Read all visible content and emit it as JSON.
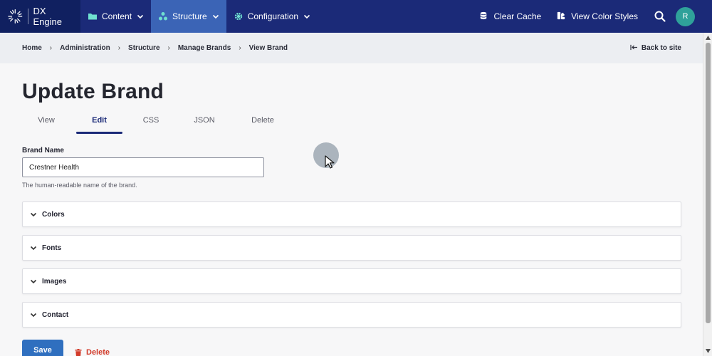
{
  "nav": {
    "brand": "DX Engine",
    "items": [
      {
        "label": "Content",
        "icon": "folder-icon"
      },
      {
        "label": "Structure",
        "icon": "sitemap-icon",
        "active": true
      },
      {
        "label": "Configuration",
        "icon": "gear-icon"
      }
    ],
    "clear_cache": "Clear Cache",
    "view_color_styles": "View Color Styles",
    "avatar_initial": "R"
  },
  "breadcrumb": [
    "Home",
    "Administration",
    "Structure",
    "Manage Brands",
    "View Brand"
  ],
  "breadcrumb_sep": "›",
  "back_to_site": "Back to site",
  "page": {
    "title": "Update Brand",
    "tabs": [
      "View",
      "Edit",
      "CSS",
      "JSON",
      "Delete"
    ],
    "active_tab": "Edit"
  },
  "form": {
    "brand_name_label": "Brand Name",
    "brand_name_value": "Crestner Health",
    "brand_name_desc": "The human-readable name of the brand.",
    "sections": [
      "Colors",
      "Fonts",
      "Images",
      "Contact"
    ],
    "save_label": "Save",
    "delete_label": "Delete"
  },
  "colors": {
    "nav_bg": "#1b2a78",
    "nav_active": "#3b64b6",
    "primary_button": "#2f6fbf",
    "danger": "#d23b2a",
    "avatar": "#2fa19a"
  }
}
